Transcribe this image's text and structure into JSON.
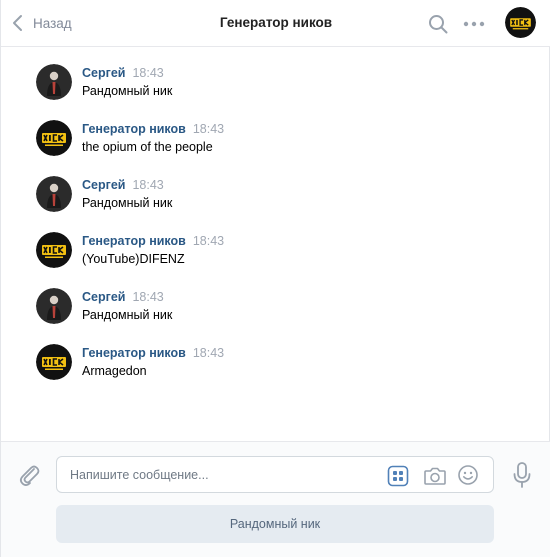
{
  "header": {
    "back_label": "Назад",
    "title": "Генератор ников"
  },
  "colors": {
    "link_blue": "#2a5885",
    "icon_gray": "#99a2ad",
    "accent_blue": "#5181b8",
    "nick_logo_yellow": "#f2c012"
  },
  "messages": [
    {
      "sender": "Сергей",
      "time": "18:43",
      "text": "Рандомный ник",
      "avatar": "user-avatar"
    },
    {
      "sender": "Генератор ников",
      "time": "18:43",
      "text": "the opium of the people",
      "avatar": "nick-bot-avatar"
    },
    {
      "sender": "Сергей",
      "time": "18:43",
      "text": "Рандомный ник",
      "avatar": "user-avatar"
    },
    {
      "sender": "Генератор ников",
      "time": "18:43",
      "text": "(YouTube)DIFENZ",
      "avatar": "nick-bot-avatar"
    },
    {
      "sender": "Сергей",
      "time": "18:43",
      "text": "Рандомный ник",
      "avatar": "user-avatar"
    },
    {
      "sender": "Генератор ников",
      "time": "18:43",
      "text": "Armagedon",
      "avatar": "nick-bot-avatar"
    }
  ],
  "composer": {
    "placeholder": "Напишите сообщение...",
    "keyboard_button_label": "Рандомный ник"
  },
  "icons": {
    "back": "chevron-left-icon",
    "search": "search-icon",
    "more": "more-dots-icon",
    "attach": "paperclip-icon",
    "keyboard": "bot-keyboard-icon",
    "camera": "camera-icon",
    "smile": "smile-icon",
    "mic": "microphone-icon"
  }
}
